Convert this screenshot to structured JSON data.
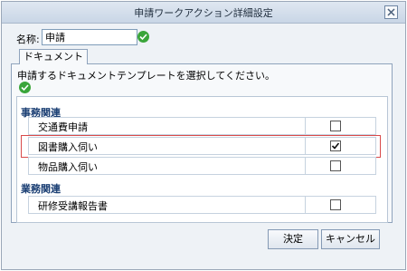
{
  "dialog": {
    "title": "申請ワークアクション詳細設定",
    "name_label": "名称:",
    "name_value": "申請",
    "tab_label": "ドキュメント",
    "instruction": "申請するドキュメントテンプレートを選択してください。",
    "groups": [
      {
        "title": "事務関連",
        "items": [
          {
            "label": "交通費申請",
            "checked": false
          },
          {
            "label": "図書購入伺い",
            "checked": true
          },
          {
            "label": "物品購入伺い",
            "checked": false
          }
        ]
      },
      {
        "title": "業務関連",
        "items": [
          {
            "label": "研修受講報告書",
            "checked": false
          }
        ]
      }
    ],
    "ok_label": "決定",
    "cancel_label": "キャンセル"
  }
}
